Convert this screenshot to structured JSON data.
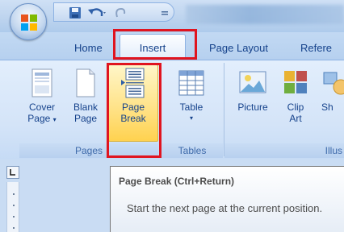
{
  "tabs": {
    "home": "Home",
    "insert": "Insert",
    "page_layout": "Page Layout",
    "references": "Refere"
  },
  "ribbon": {
    "pages_group": {
      "label": "Pages",
      "buttons": [
        {
          "line1": "Cover",
          "line2": "Page",
          "has_dropdown": true,
          "icon": "cover-page-icon"
        },
        {
          "line1": "Blank",
          "line2": "Page",
          "icon": "blank-page-icon"
        },
        {
          "line1": "Page",
          "line2": "Break",
          "icon": "page-break-icon",
          "state": "hover"
        }
      ]
    },
    "tables_group": {
      "label": "Tables",
      "buttons": [
        {
          "line1": "Table",
          "has_dropdown": true,
          "icon": "table-icon"
        }
      ]
    },
    "illustrations_group": {
      "label": "Illus",
      "buttons": [
        {
          "line1": "Picture",
          "icon": "picture-icon"
        },
        {
          "line1": "Clip",
          "line2": "Art",
          "icon": "clip-art-icon"
        },
        {
          "line1": "Sh",
          "icon": "shapes-icon"
        }
      ]
    }
  },
  "tooltip": {
    "title": "Page Break (Ctrl+Return)",
    "body": "Start the next page at the current position."
  },
  "colors": {
    "highlight_red": "#e0141f",
    "hover_gold": "#ffd24f",
    "ribbon_blue": "#d4e4f8"
  }
}
